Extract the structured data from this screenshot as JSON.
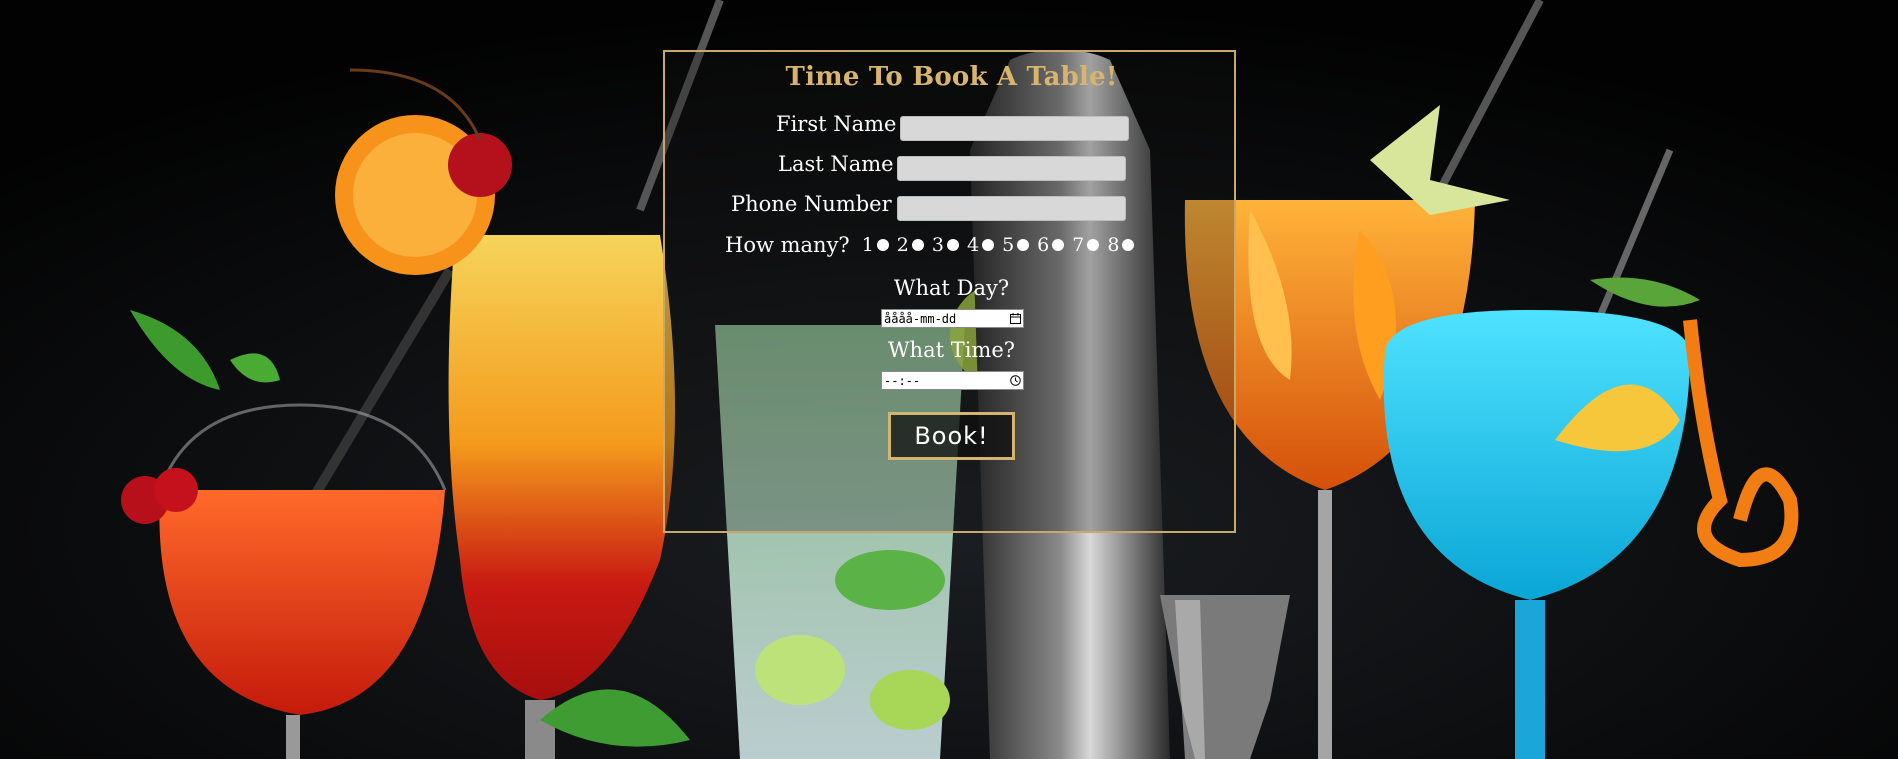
{
  "form": {
    "title": "Time To Book A Table!",
    "first_name_label": "First Name",
    "last_name_label": "Last Name",
    "phone_label": "Phone Number",
    "how_many_label": "How many?",
    "how_many_options": [
      "1",
      "2",
      "3",
      "4",
      "5",
      "6",
      "7",
      "8"
    ],
    "day_label": "What Day?",
    "day_placeholder": "åååå-mm-dd",
    "time_label": "What Time?",
    "time_placeholder": "--:--",
    "submit_label": "Book!"
  },
  "colors": {
    "accent_gold": "#d8b46d",
    "panel_border": "#c9a96a",
    "text": "#ffffff",
    "input_bg": "#d8d8d8"
  },
  "icons": {
    "day_input": "calendar-icon",
    "time_input": "clock-icon"
  }
}
